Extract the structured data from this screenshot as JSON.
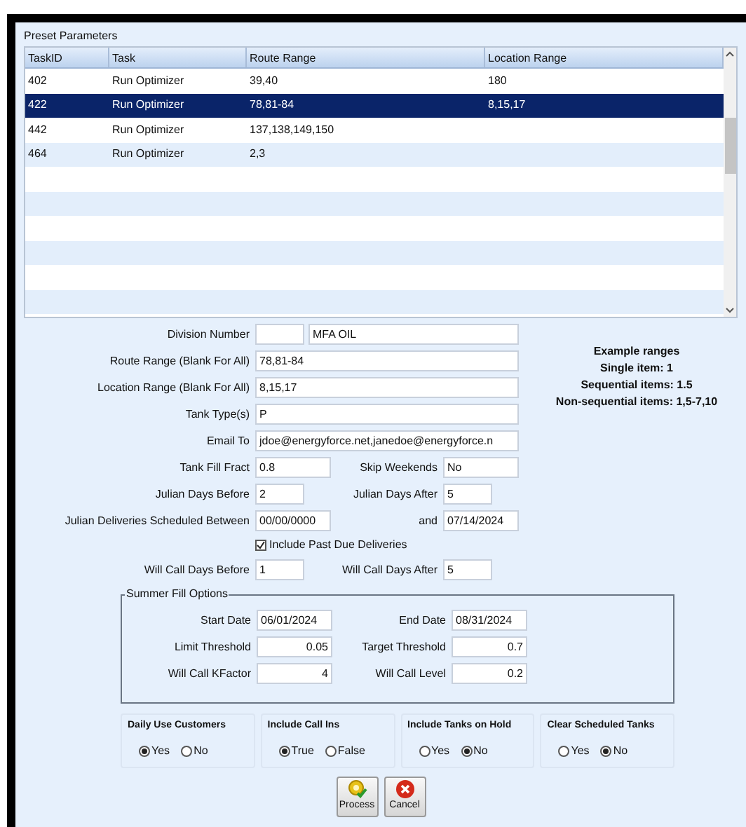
{
  "group_title": "Preset Parameters",
  "table": {
    "columns": [
      "TaskID",
      "Task",
      "Route Range",
      "Location Range"
    ],
    "rows": [
      {
        "cells": [
          "402",
          "Run Optimizer",
          "39,40",
          "180"
        ],
        "selected": false
      },
      {
        "cells": [
          "422",
          "Run Optimizer",
          "78,81-84",
          "8,15,17"
        ],
        "selected": true
      },
      {
        "cells": [
          "442",
          "Run Optimizer",
          "137,138,149,150",
          ""
        ],
        "selected": false
      },
      {
        "cells": [
          "464",
          "Run Optimizer",
          "2,3",
          ""
        ],
        "selected": false
      }
    ]
  },
  "division": {
    "label": "Division Number",
    "name": "MFA OIL"
  },
  "wide_fields": [
    {
      "label": "Route Range (Blank For All)",
      "value": "78,81-84"
    },
    {
      "label": "Location Range (Blank For All)",
      "value": "8,15,17"
    },
    {
      "label": "Tank Type(s)",
      "value": "P"
    },
    {
      "label": "Email To",
      "value": "jdoe@energyforce.net,janedoe@energyforce.n"
    }
  ],
  "pair_rows": [
    {
      "label": "Tank Fill Fract",
      "value": "0.8",
      "label2": "Skip Weekends",
      "value2": "No",
      "kind": "wide"
    },
    {
      "label": "Julian Days Before",
      "value": "2",
      "label2": "Julian Days After",
      "value2": "5",
      "kind": "short"
    },
    {
      "label": "Julian Deliveries Scheduled Between",
      "value": "00/00/0000",
      "label2": "and",
      "value2": "07/14/2024",
      "kind": "wide"
    }
  ],
  "past_due": {
    "label": "Include Past Due Deliveries",
    "checked": true
  },
  "will_call": {
    "label": "Will Call Days Before",
    "value": "1",
    "label2": "Will Call Days After",
    "value2": "5"
  },
  "example": {
    "title": "Example ranges",
    "lines": [
      "Single item: 1",
      "Sequential items: 1.5",
      "Non-sequential items: 1,5-7,10"
    ]
  },
  "summer": {
    "title": "Summer Fill Options",
    "rows": [
      {
        "label": "Start Date",
        "value": "06/01/2024",
        "label2": "End Date",
        "value2": "08/31/2024",
        "kind": "date"
      },
      {
        "label": "Limit Threshold",
        "value": "0.05",
        "label2": "Target Threshold",
        "value2": "0.7",
        "kind": "number"
      },
      {
        "label": "Will Call KFactor",
        "value": "4",
        "label2": "Will Call Level",
        "value2": "0.2",
        "kind": "number"
      }
    ]
  },
  "radio_groups": [
    {
      "title": "Daily Use Customers",
      "options": [
        {
          "label": "Yes",
          "selected": true
        },
        {
          "label": "No",
          "selected": false
        }
      ]
    },
    {
      "title": "Include Call Ins",
      "options": [
        {
          "label": "True",
          "selected": true
        },
        {
          "label": "False",
          "selected": false
        }
      ]
    },
    {
      "title": "Include Tanks on Hold",
      "options": [
        {
          "label": "Yes",
          "selected": false
        },
        {
          "label": "No",
          "selected": true
        }
      ]
    },
    {
      "title": "Clear Scheduled Tanks",
      "options": [
        {
          "label": "Yes",
          "selected": false
        },
        {
          "label": "No",
          "selected": true
        }
      ]
    }
  ],
  "buttons": [
    {
      "label": "Process",
      "kind": "process"
    },
    {
      "label": "Cancel",
      "kind": "cancel"
    }
  ]
}
